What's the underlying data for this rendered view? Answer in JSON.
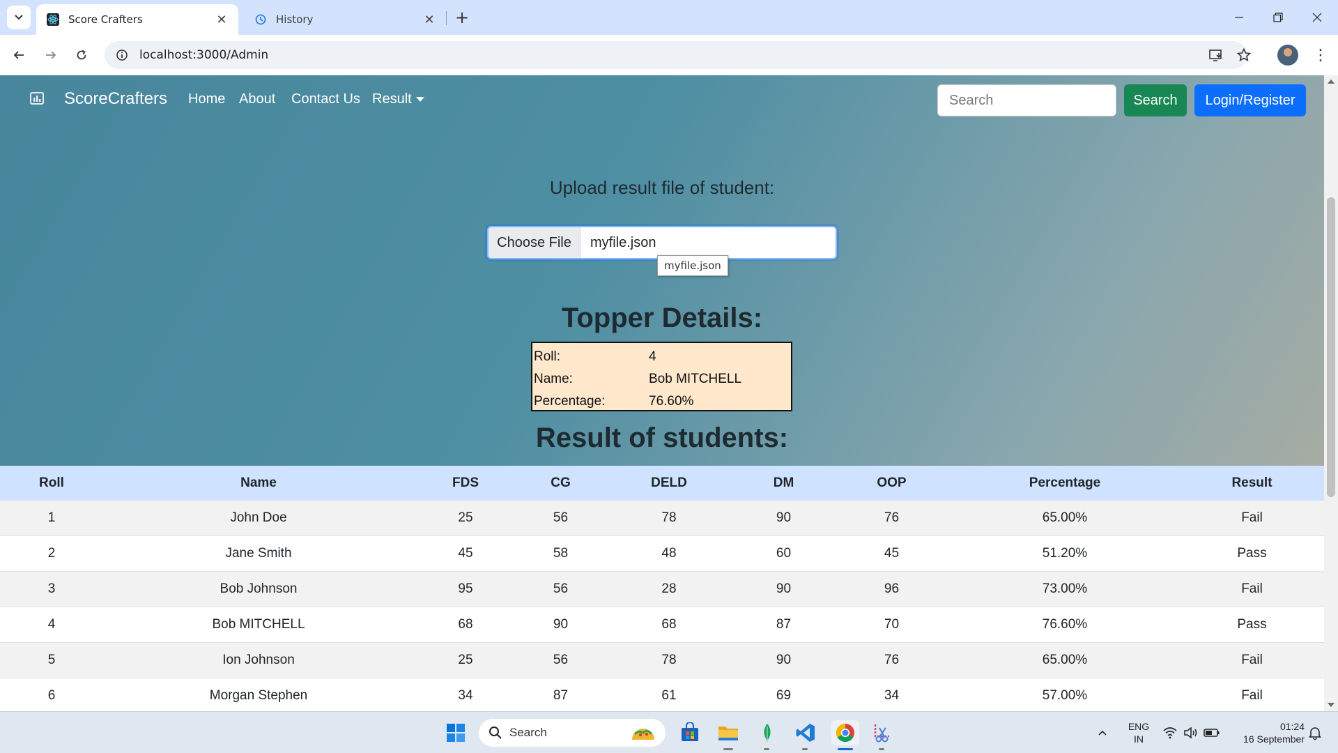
{
  "browser": {
    "tabs": [
      {
        "title": "Score Crafters",
        "active": true
      },
      {
        "title": "History",
        "active": false
      }
    ],
    "url": "localhost:3000/Admin"
  },
  "app": {
    "brand": "ScoreCrafters",
    "nav": {
      "home": "Home",
      "about": "About",
      "contact": "Contact Us",
      "result": "Result"
    },
    "search_placeholder": "Search",
    "search_button": "Search",
    "login_button": "Login/Register"
  },
  "upload": {
    "title": "Upload result file of student:",
    "choose_label": "Choose File",
    "file_name": "myfile.json",
    "tooltip": "myfile.json"
  },
  "topper": {
    "title": "Topper Details:",
    "roll_label": "Roll:",
    "roll": "4",
    "name_label": "Name:",
    "name": "Bob MITCHELL",
    "percentage_label": "Percentage:",
    "percentage": "76.60%"
  },
  "results": {
    "title": "Result of students:",
    "headers": [
      "Roll",
      "Name",
      "FDS",
      "CG",
      "DELD",
      "DM",
      "OOP",
      "Percentage",
      "Result"
    ],
    "rows": [
      [
        "1",
        "John Doe",
        "25",
        "56",
        "78",
        "90",
        "76",
        "65.00%",
        "Fail"
      ],
      [
        "2",
        "Jane Smith",
        "45",
        "58",
        "48",
        "60",
        "45",
        "51.20%",
        "Pass"
      ],
      [
        "3",
        "Bob Johnson",
        "95",
        "56",
        "28",
        "90",
        "96",
        "73.00%",
        "Fail"
      ],
      [
        "4",
        "Bob MITCHELL",
        "68",
        "90",
        "68",
        "87",
        "70",
        "76.60%",
        "Pass"
      ],
      [
        "5",
        "Ion Johnson",
        "25",
        "56",
        "78",
        "90",
        "76",
        "65.00%",
        "Fail"
      ],
      [
        "6",
        "Morgan Stephen",
        "34",
        "87",
        "61",
        "69",
        "34",
        "57.00%",
        "Fail"
      ]
    ]
  },
  "taskbar": {
    "search_label": "Search",
    "lang_top": "ENG",
    "lang_bottom": "IN",
    "time": "01:24",
    "date": "16 September"
  },
  "colors": {
    "tabbar": "#d3e3fd",
    "hero_start": "#47869c",
    "hero_end": "#a6aca3",
    "green_button": "#198754",
    "blue_button": "#0d6efd",
    "table_header": "#cfe2ff",
    "topper_bg": "#ffe8cc"
  }
}
